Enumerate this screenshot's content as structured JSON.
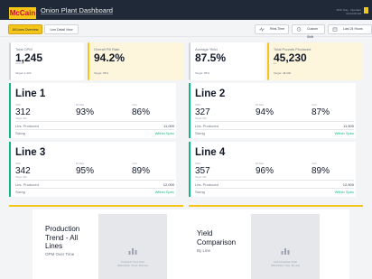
{
  "header": {
    "logo": "McCain",
    "title": "Onion Plant Dashboard",
    "meta_line1": "Shift: Day · Operator",
    "meta_line2": "10:24:05 AM"
  },
  "toolbar": {
    "tabs": [
      "All Lines Overview",
      "Line Detail View"
    ],
    "buttons": [
      "Real-Time",
      "Custom Shift",
      "Last 24 Hours"
    ]
  },
  "kpis": [
    {
      "label": "Total OPM",
      "value": "1,245",
      "unit": "units/min",
      "target": "Target: 1,200"
    },
    {
      "label": "Overall Fill Rate",
      "value": "94.2%",
      "unit": "",
      "target": "Target: 95%"
    },
    {
      "label": "Average Yield",
      "value": "87.5%",
      "unit": "",
      "target": "Target: 85%"
    },
    {
      "label": "Total Pounds Produced",
      "value": "45,230",
      "unit": "lbs",
      "target": "Target: 48,000"
    }
  ],
  "lines": [
    {
      "name": "Line 1",
      "opm_label": "OPM",
      "opm": "312",
      "opm_target": "Target: 300",
      "fill_label": "Fill Rate",
      "fill": "93%",
      "yield_label": "Yield",
      "yield": "86%",
      "produced_label": "Lbs. Produced",
      "produced": "11,000",
      "sizing_label": "Sizing",
      "sizing": "Within Spec"
    },
    {
      "name": "Line 2",
      "opm_label": "OPM",
      "opm": "327",
      "opm_target": "Target: 300",
      "fill_label": "Fill Rate",
      "fill": "94%",
      "yield_label": "Yield",
      "yield": "87%",
      "produced_label": "Lbs. Produced",
      "produced": "11,500",
      "sizing_label": "Sizing",
      "sizing": "Within Spec"
    },
    {
      "name": "Line 3",
      "opm_label": "OPM",
      "opm": "342",
      "opm_target": "Target: 300",
      "fill_label": "Fill Rate",
      "fill": "95%",
      "yield_label": "Yield",
      "yield": "89%",
      "produced_label": "Lbs. Produced",
      "produced": "12,000",
      "sizing_label": "Sizing",
      "sizing": "Within Spec"
    },
    {
      "name": "Line 4",
      "opm_label": "OPM",
      "opm": "357",
      "opm_target": "Target: 300",
      "fill_label": "Fill Rate",
      "fill": "96%",
      "yield_label": "Yield",
      "yield": "89%",
      "produced_label": "Lbs. Produced",
      "produced": "12,500",
      "sizing_label": "Sizing",
      "sizing": "Within Spec"
    }
  ],
  "charts": [
    {
      "title_l1": "Production",
      "title_l2": "Trend - All",
      "title_l3": "Lines",
      "subtitle": "OPM Over Time",
      "placeholder_l1": "Production Trend Chart",
      "placeholder_l2": "(Placeholder: Trend - All Lines)"
    },
    {
      "title_l1": "Yield",
      "title_l2": "Comparison",
      "subtitle": "By Line",
      "placeholder_l1": "Yield Comparison Chart",
      "placeholder_l2": "(Placeholder: Yield - By Line)"
    }
  ],
  "colors": {
    "brand_yellow": "#f5c518",
    "brand_red": "#c8102e",
    "status_green": "#10b981",
    "header_dark": "#1f2937"
  },
  "icons": {
    "realtime": "pulse-icon",
    "custom": "clock-icon",
    "last24": "calendar-icon",
    "chart_placeholder": "bar-chart-icon"
  }
}
